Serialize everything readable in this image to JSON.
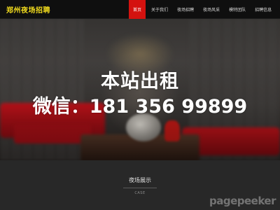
{
  "header": {
    "logo": "郑州夜场招聘",
    "nav": [
      {
        "label": "首页",
        "active": true
      },
      {
        "label": "关于我们",
        "active": false
      },
      {
        "label": "夜场招聘",
        "active": false
      },
      {
        "label": "夜场风采",
        "active": false
      },
      {
        "label": "模特团队",
        "active": false
      },
      {
        "label": "招聘信息",
        "active": false
      }
    ]
  },
  "banner": {
    "line1": "本站出租",
    "line2": "微信：181 356 99899"
  },
  "section": {
    "title": "夜场展示",
    "subtitle": "CASE"
  },
  "watermark": "pagepeeker",
  "colors": {
    "accent": "#d4120f",
    "logo": "#f2dc1e",
    "header_bg": "#0f0f0f",
    "section_bg": "#282828"
  }
}
